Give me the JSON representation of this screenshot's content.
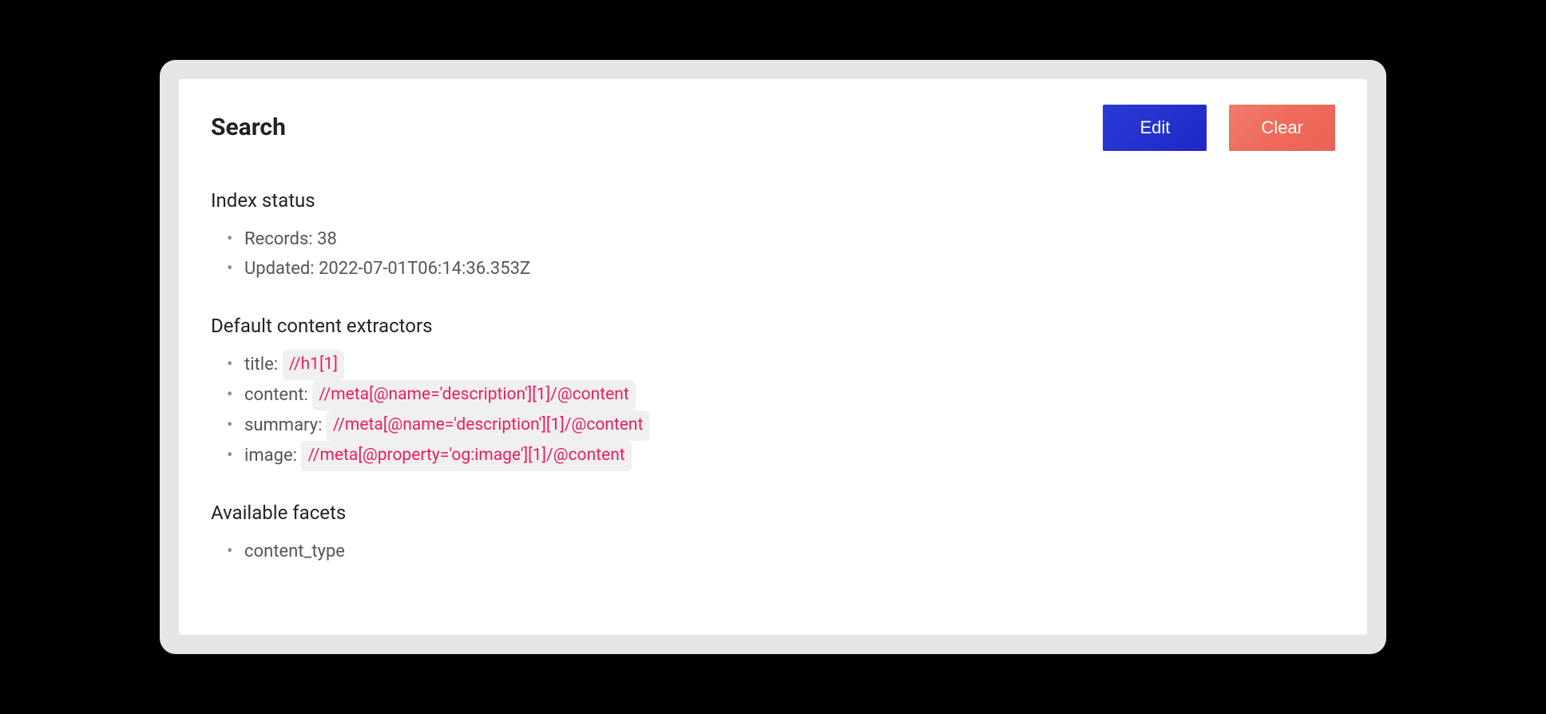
{
  "header": {
    "title": "Search",
    "edit_label": "Edit",
    "clear_label": "Clear"
  },
  "sections": {
    "index_status": {
      "heading": "Index status",
      "records_label": "Records:",
      "records_value": "38",
      "updated_label": "Updated:",
      "updated_value": "2022-07-01T06:14:36.353Z"
    },
    "extractors": {
      "heading": "Default content extractors",
      "items": [
        {
          "label": "title:",
          "code": "//h1[1]"
        },
        {
          "label": "content:",
          "code": "//meta[@name='description'][1]/@content"
        },
        {
          "label": "summary:",
          "code": "//meta[@name='description'][1]/@content"
        },
        {
          "label": "image:",
          "code": "//meta[@property='og:image'][1]/@content"
        }
      ]
    },
    "facets": {
      "heading": "Available facets",
      "items": [
        "content_type"
      ]
    }
  }
}
